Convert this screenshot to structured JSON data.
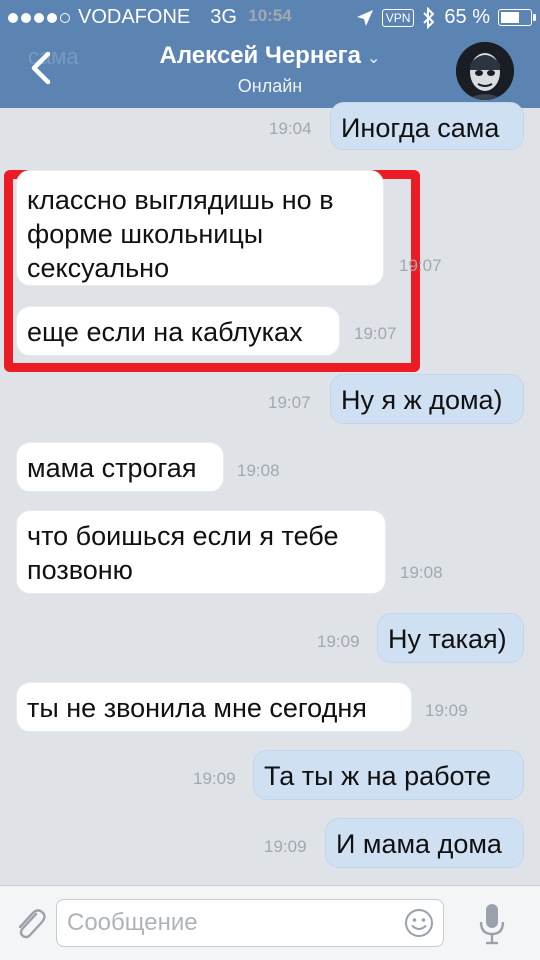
{
  "status_bar": {
    "carrier": "VODAFONE",
    "network": "3G",
    "time": "10:54",
    "vpn": "VPN",
    "battery": "65 %",
    "battery_level": 0.65
  },
  "header": {
    "back_ghost": "сама",
    "name": "Алексей Чернега",
    "chevron": "⌄",
    "status": "Онлайн"
  },
  "messages": [
    {
      "dir": "out",
      "text": "Иногда сама",
      "time": "19:04"
    },
    {
      "dir": "in",
      "text": "классно выглядишь но в форме школьницы сексуально",
      "time": "19:07"
    },
    {
      "dir": "in",
      "text": "еще если на каблуках",
      "time": "19:07"
    },
    {
      "dir": "out",
      "text": "Ну я ж дома)",
      "time": "19:07"
    },
    {
      "dir": "in",
      "text": "мама строгая",
      "time": "19:08"
    },
    {
      "dir": "in",
      "text": "что боишься если я тебе позвоню",
      "time": "19:08"
    },
    {
      "dir": "out",
      "text": "Ну такая)",
      "time": "19:09"
    },
    {
      "dir": "in",
      "text": "ты не звонила мне сегодня",
      "time": "19:09"
    },
    {
      "dir": "out",
      "text": "Та ты ж на работе",
      "time": "19:09"
    },
    {
      "dir": "out",
      "text": "И мама дома",
      "time": "19:09"
    }
  ],
  "input": {
    "placeholder": "Сообщение"
  },
  "icons": {
    "back": "back-chevron-icon",
    "location": "location-arrow-icon",
    "bluetooth": "bluetooth-icon",
    "attach": "paperclip-icon",
    "emoji": "smiley-icon",
    "mic": "microphone-icon"
  },
  "colors": {
    "header": "#5b84b3",
    "background": "#dfe3e8",
    "incoming": "#ffffff",
    "outgoing": "#cfe0f3",
    "highlight": "#ec1c24"
  }
}
